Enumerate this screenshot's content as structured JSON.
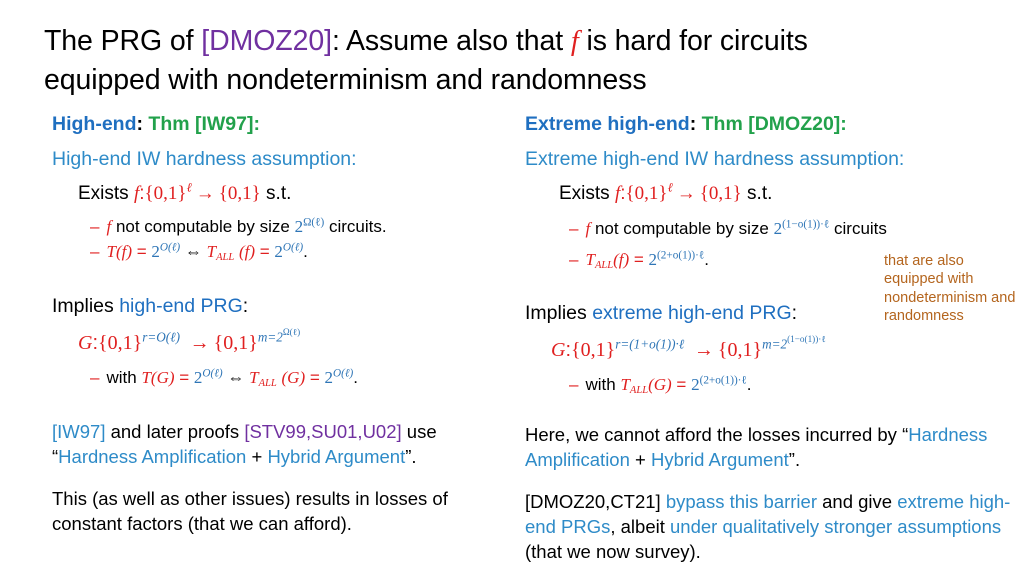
{
  "slide": {
    "title": {
      "line1_a": "The PRG of ",
      "line1_ref": "[DMOZ20]",
      "line1_b": ": Assume also that ",
      "line1_f": "f",
      "line1_c": " is hard for circuits",
      "line2": "equipped with nondeterminism and randomness"
    },
    "left": {
      "header_label": "High-end",
      "header_colon": ":",
      "header_thm": "Thm [IW97]:",
      "subheader": "High-end IW hardness assumption:",
      "exists_word": "Exists",
      "exists_fn": "f",
      "exists_colon": ":",
      "exists_domain": "{0,1}",
      "exists_domain_sup": "ℓ",
      "exists_arrow": "→",
      "exists_range": "{0,1}",
      "exists_st": "s.t.",
      "bullet1": {
        "dash": "–",
        "fn": "f",
        "text_a": "not computable by size",
        "base": "2",
        "exp": "Ω(ℓ)",
        "text_b": "circuits."
      },
      "bullet2": {
        "dash": "–",
        "lhs_T": "T",
        "lhs_arg": "(f)",
        "eq": "=",
        "base": "2",
        "exp": "O(ℓ)",
        "iff": "⇔",
        "rhs_T": "T",
        "rhs_sub": "ALL",
        "rhs_arg": "(f)",
        "eq2": "=",
        "base2": "2",
        "exp2": "O(ℓ)",
        "period": "."
      },
      "implies_word": "Implies",
      "implies_hl": "high-end PRG",
      "implies_colon": ":",
      "prg": {
        "G": "G",
        "colon": ":",
        "domain": "{0,1}",
        "domain_sup": "r=O(ℓ)",
        "arrow": "→",
        "range": "{0,1}",
        "range_sup_m": "m=2",
        "range_sup_exp": "Ω(ℓ)"
      },
      "with": {
        "dash": "–",
        "word": "with",
        "lhs_T": "T",
        "lhs_arg": "(G)",
        "eq": "=",
        "base": "2",
        "exp": "O(ℓ)",
        "iff": "⇔",
        "rhs_T": "T",
        "rhs_sub": "ALL",
        "rhs_arg": "(G)",
        "eq2": "=",
        "base2": "2",
        "exp2": "O(ℓ)",
        "period": "."
      },
      "para1": {
        "ref1": "[IW97]",
        "t1": " and later proofs ",
        "ref2": "[STV99,SU01,U02]",
        "t2": " use ",
        "q_open": "“",
        "hl1": "Hardness Amplification",
        "plus": " + ",
        "hl2": "Hybrid Argument",
        "q_close": "”."
      },
      "para2": "This (as well as other issues) results in losses of constant factors (that we can afford)."
    },
    "right": {
      "header_label": "Extreme high-end",
      "header_colon": ":",
      "header_thm": "Thm [DMOZ20]:",
      "subheader": "Extreme high-end IW hardness assumption:",
      "exists_word": "Exists",
      "exists_fn": "f",
      "exists_colon": ":",
      "exists_domain": "{0,1}",
      "exists_domain_sup": "ℓ",
      "exists_arrow": "→",
      "exists_range": "{0,1}",
      "exists_st": "s.t.",
      "bullet1": {
        "dash": "–",
        "fn": "f",
        "text_a": "not computable by size",
        "base": "2",
        "exp": "(1−o(1))·ℓ",
        "text_b": "circuits"
      },
      "bullet2": {
        "dash": "–",
        "lhs_T": "T",
        "lhs_sub": "ALL",
        "lhs_arg": "(f)",
        "eq": "=",
        "base": "2",
        "exp": "(2+o(1))·ℓ",
        "period": "."
      },
      "sidenote": "that are also equipped with nondeterminism and randomness",
      "implies_word": "Implies",
      "implies_hl": "extreme high-end PRG",
      "implies_colon": ":",
      "prg": {
        "G": "G",
        "colon": ":",
        "domain": "{0,1}",
        "domain_sup": "r=(1+o(1))·ℓ",
        "arrow": "→",
        "range": "{0,1}",
        "range_sup_m": "m=2",
        "range_sup_exp": "(1−o(1))·ℓ"
      },
      "with": {
        "dash": "–",
        "word": "with",
        "lhs_T": "T",
        "lhs_sub": "ALL",
        "lhs_arg": "(G)",
        "eq": "=",
        "base": "2",
        "exp": "(2+o(1))·ℓ",
        "period": "."
      },
      "para1": {
        "t1": "Here, we cannot afford the losses incurred by ",
        "q_open": "“",
        "hl1": "Hardness Amplification",
        "plus": " + ",
        "hl2": "Hybrid Argument",
        "q_close": "”."
      },
      "para2": {
        "ref": "[DMOZ20,CT21]",
        "t1": " ",
        "hl1": "bypass this barrier",
        "t2": " and give ",
        "hl2": "extreme high-end PRGs",
        "t3": ", albeit ",
        "hl3": "under qualitatively stronger assumptions",
        "t4": " (that we now survey)."
      }
    }
  },
  "colors": {
    "red": "#E02020",
    "blue": "#2E75B6",
    "dark_blue": "#1F6FC0",
    "light_blue": "#2E8BC8",
    "green": "#22A14B",
    "purple": "#7030A0",
    "brown": "#B4651E",
    "black": "#000000"
  }
}
